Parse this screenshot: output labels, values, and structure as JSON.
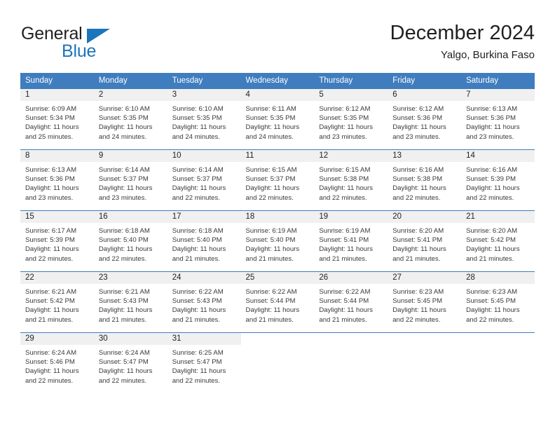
{
  "logo": {
    "word_one": "General",
    "word_two": "Blue",
    "triangle_color": "#1b75bb",
    "text_color": "#231f20"
  },
  "header": {
    "title": "December 2024",
    "subtitle": "Yalgo, Burkina Faso"
  },
  "theme": {
    "header_bar_color": "#3f7dbf",
    "day_band_color": "#f0f0f0",
    "row_rule_color": "#3f7dbf",
    "body_text_color": "#3a3a3a"
  },
  "weekday_headers": [
    "Sunday",
    "Monday",
    "Tuesday",
    "Wednesday",
    "Thursday",
    "Friday",
    "Saturday"
  ],
  "weeks": [
    [
      {
        "day": "1",
        "sunrise": "Sunrise: 6:09 AM",
        "sunset": "Sunset: 5:34 PM",
        "daylight_1": "Daylight: 11 hours",
        "daylight_2": "and 25 minutes."
      },
      {
        "day": "2",
        "sunrise": "Sunrise: 6:10 AM",
        "sunset": "Sunset: 5:35 PM",
        "daylight_1": "Daylight: 11 hours",
        "daylight_2": "and 24 minutes."
      },
      {
        "day": "3",
        "sunrise": "Sunrise: 6:10 AM",
        "sunset": "Sunset: 5:35 PM",
        "daylight_1": "Daylight: 11 hours",
        "daylight_2": "and 24 minutes."
      },
      {
        "day": "4",
        "sunrise": "Sunrise: 6:11 AM",
        "sunset": "Sunset: 5:35 PM",
        "daylight_1": "Daylight: 11 hours",
        "daylight_2": "and 24 minutes."
      },
      {
        "day": "5",
        "sunrise": "Sunrise: 6:12 AM",
        "sunset": "Sunset: 5:35 PM",
        "daylight_1": "Daylight: 11 hours",
        "daylight_2": "and 23 minutes."
      },
      {
        "day": "6",
        "sunrise": "Sunrise: 6:12 AM",
        "sunset": "Sunset: 5:36 PM",
        "daylight_1": "Daylight: 11 hours",
        "daylight_2": "and 23 minutes."
      },
      {
        "day": "7",
        "sunrise": "Sunrise: 6:13 AM",
        "sunset": "Sunset: 5:36 PM",
        "daylight_1": "Daylight: 11 hours",
        "daylight_2": "and 23 minutes."
      }
    ],
    [
      {
        "day": "8",
        "sunrise": "Sunrise: 6:13 AM",
        "sunset": "Sunset: 5:36 PM",
        "daylight_1": "Daylight: 11 hours",
        "daylight_2": "and 23 minutes."
      },
      {
        "day": "9",
        "sunrise": "Sunrise: 6:14 AM",
        "sunset": "Sunset: 5:37 PM",
        "daylight_1": "Daylight: 11 hours",
        "daylight_2": "and 23 minutes."
      },
      {
        "day": "10",
        "sunrise": "Sunrise: 6:14 AM",
        "sunset": "Sunset: 5:37 PM",
        "daylight_1": "Daylight: 11 hours",
        "daylight_2": "and 22 minutes."
      },
      {
        "day": "11",
        "sunrise": "Sunrise: 6:15 AM",
        "sunset": "Sunset: 5:37 PM",
        "daylight_1": "Daylight: 11 hours",
        "daylight_2": "and 22 minutes."
      },
      {
        "day": "12",
        "sunrise": "Sunrise: 6:15 AM",
        "sunset": "Sunset: 5:38 PM",
        "daylight_1": "Daylight: 11 hours",
        "daylight_2": "and 22 minutes."
      },
      {
        "day": "13",
        "sunrise": "Sunrise: 6:16 AM",
        "sunset": "Sunset: 5:38 PM",
        "daylight_1": "Daylight: 11 hours",
        "daylight_2": "and 22 minutes."
      },
      {
        "day": "14",
        "sunrise": "Sunrise: 6:16 AM",
        "sunset": "Sunset: 5:39 PM",
        "daylight_1": "Daylight: 11 hours",
        "daylight_2": "and 22 minutes."
      }
    ],
    [
      {
        "day": "15",
        "sunrise": "Sunrise: 6:17 AM",
        "sunset": "Sunset: 5:39 PM",
        "daylight_1": "Daylight: 11 hours",
        "daylight_2": "and 22 minutes."
      },
      {
        "day": "16",
        "sunrise": "Sunrise: 6:18 AM",
        "sunset": "Sunset: 5:40 PM",
        "daylight_1": "Daylight: 11 hours",
        "daylight_2": "and 22 minutes."
      },
      {
        "day": "17",
        "sunrise": "Sunrise: 6:18 AM",
        "sunset": "Sunset: 5:40 PM",
        "daylight_1": "Daylight: 11 hours",
        "daylight_2": "and 21 minutes."
      },
      {
        "day": "18",
        "sunrise": "Sunrise: 6:19 AM",
        "sunset": "Sunset: 5:40 PM",
        "daylight_1": "Daylight: 11 hours",
        "daylight_2": "and 21 minutes."
      },
      {
        "day": "19",
        "sunrise": "Sunrise: 6:19 AM",
        "sunset": "Sunset: 5:41 PM",
        "daylight_1": "Daylight: 11 hours",
        "daylight_2": "and 21 minutes."
      },
      {
        "day": "20",
        "sunrise": "Sunrise: 6:20 AM",
        "sunset": "Sunset: 5:41 PM",
        "daylight_1": "Daylight: 11 hours",
        "daylight_2": "and 21 minutes."
      },
      {
        "day": "21",
        "sunrise": "Sunrise: 6:20 AM",
        "sunset": "Sunset: 5:42 PM",
        "daylight_1": "Daylight: 11 hours",
        "daylight_2": "and 21 minutes."
      }
    ],
    [
      {
        "day": "22",
        "sunrise": "Sunrise: 6:21 AM",
        "sunset": "Sunset: 5:42 PM",
        "daylight_1": "Daylight: 11 hours",
        "daylight_2": "and 21 minutes."
      },
      {
        "day": "23",
        "sunrise": "Sunrise: 6:21 AM",
        "sunset": "Sunset: 5:43 PM",
        "daylight_1": "Daylight: 11 hours",
        "daylight_2": "and 21 minutes."
      },
      {
        "day": "24",
        "sunrise": "Sunrise: 6:22 AM",
        "sunset": "Sunset: 5:43 PM",
        "daylight_1": "Daylight: 11 hours",
        "daylight_2": "and 21 minutes."
      },
      {
        "day": "25",
        "sunrise": "Sunrise: 6:22 AM",
        "sunset": "Sunset: 5:44 PM",
        "daylight_1": "Daylight: 11 hours",
        "daylight_2": "and 21 minutes."
      },
      {
        "day": "26",
        "sunrise": "Sunrise: 6:22 AM",
        "sunset": "Sunset: 5:44 PM",
        "daylight_1": "Daylight: 11 hours",
        "daylight_2": "and 21 minutes."
      },
      {
        "day": "27",
        "sunrise": "Sunrise: 6:23 AM",
        "sunset": "Sunset: 5:45 PM",
        "daylight_1": "Daylight: 11 hours",
        "daylight_2": "and 22 minutes."
      },
      {
        "day": "28",
        "sunrise": "Sunrise: 6:23 AM",
        "sunset": "Sunset: 5:45 PM",
        "daylight_1": "Daylight: 11 hours",
        "daylight_2": "and 22 minutes."
      }
    ],
    [
      {
        "day": "29",
        "sunrise": "Sunrise: 6:24 AM",
        "sunset": "Sunset: 5:46 PM",
        "daylight_1": "Daylight: 11 hours",
        "daylight_2": "and 22 minutes."
      },
      {
        "day": "30",
        "sunrise": "Sunrise: 6:24 AM",
        "sunset": "Sunset: 5:47 PM",
        "daylight_1": "Daylight: 11 hours",
        "daylight_2": "and 22 minutes."
      },
      {
        "day": "31",
        "sunrise": "Sunrise: 6:25 AM",
        "sunset": "Sunset: 5:47 PM",
        "daylight_1": "Daylight: 11 hours",
        "daylight_2": "and 22 minutes."
      },
      {
        "day": "",
        "sunrise": "",
        "sunset": "",
        "daylight_1": "",
        "daylight_2": ""
      },
      {
        "day": "",
        "sunrise": "",
        "sunset": "",
        "daylight_1": "",
        "daylight_2": ""
      },
      {
        "day": "",
        "sunrise": "",
        "sunset": "",
        "daylight_1": "",
        "daylight_2": ""
      },
      {
        "day": "",
        "sunrise": "",
        "sunset": "",
        "daylight_1": "",
        "daylight_2": ""
      }
    ]
  ]
}
